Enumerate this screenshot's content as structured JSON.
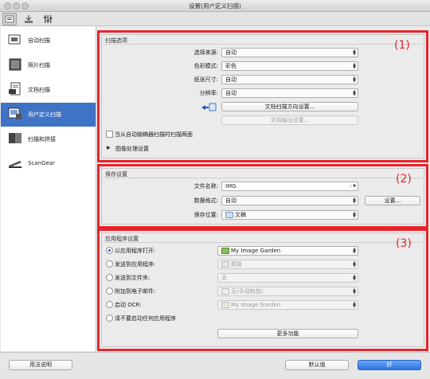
{
  "window": {
    "title": "设置(用户定义扫描)"
  },
  "toolbar": {
    "icons": [
      "scan-settings-icon",
      "save-settings-icon",
      "general-settings-icon"
    ]
  },
  "sidebar": {
    "items": [
      {
        "label": "自动扫描",
        "icon": "auto-scan-icon"
      },
      {
        "label": "照片扫描",
        "icon": "photo-scan-icon"
      },
      {
        "label": "文档扫描",
        "icon": "document-scan-icon"
      },
      {
        "label": "用户定义扫描",
        "icon": "custom-scan-icon",
        "active": true
      },
      {
        "label": "扫描和拼接",
        "icon": "stitch-scan-icon"
      },
      {
        "label": "ScanGear",
        "icon": "scangear-icon"
      }
    ]
  },
  "scan_options": {
    "title": "扫描选项",
    "number": "(1)",
    "source_label": "选择来源:",
    "source_value": "自动",
    "color_label": "色彩模式:",
    "color_value": "彩色",
    "paper_label": "纸张尺寸:",
    "paper_value": "自动",
    "resolution_label": "分辨率:",
    "resolution_value": "自动",
    "orientation_button": "文档扫描方向设置...",
    "output_button": "文档输出设置...",
    "duplex_label": "当从自动输稿器扫描时扫描两面",
    "image_processing_label": "图像处理设置"
  },
  "save_settings": {
    "title": "保存设置",
    "number": "(2)",
    "filename_label": "文件名称:",
    "filename_value": "IMG",
    "format_label": "数据格式:",
    "format_value": "自动",
    "settings_button": "设置...",
    "location_label": "保存位置:",
    "location_value": "文稿"
  },
  "app_settings": {
    "title": "应用程序设置",
    "number": "(3)",
    "open_with_label": "以应用程序打开:",
    "open_with_value": "My Image Garden",
    "send_app_label": "发送到应用程序:",
    "send_app_value": "预览",
    "send_folder_label": "发送到文件夹:",
    "send_folder_value": "无",
    "attach_email_label": "附加到电子邮件:",
    "attach_email_value": "无(手动附加)",
    "ocr_label": "启动 OCR:",
    "ocr_value": "My Image Garden",
    "no_app_label": "请不要启动任何应用程序",
    "more_button": "更多功能"
  },
  "bottom": {
    "help_button": "用法说明",
    "defaults_button": "默认值",
    "ok_button": "好"
  },
  "colors": {
    "accent": "#3f73c5",
    "highlight_border": "#e8242c"
  }
}
